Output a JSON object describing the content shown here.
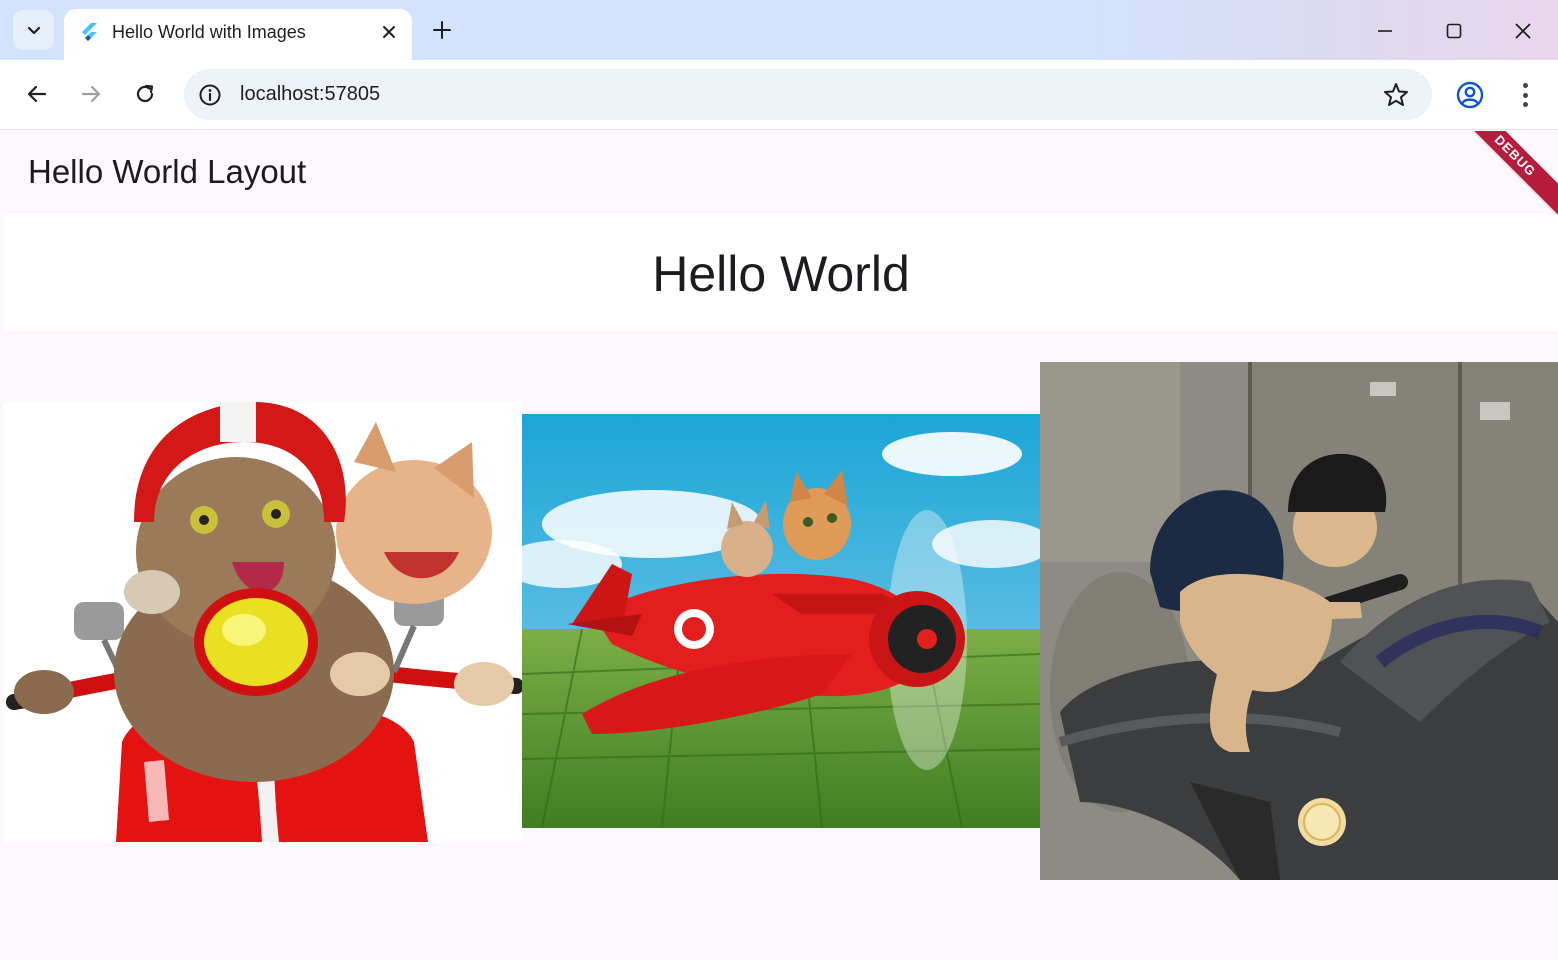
{
  "browser": {
    "tab_title": "Hello World with Images",
    "url": "localhost:57805"
  },
  "app": {
    "appbar_title": "Hello World Layout",
    "debug_banner": "DEBUG",
    "heading": "Hello World",
    "images": [
      {
        "description": "cat-scooter-image"
      },
      {
        "description": "cat-airplane-image"
      },
      {
        "description": "cat-motorbike-image"
      }
    ]
  },
  "colors": {
    "tabstrip": "#d3e3fd",
    "app_background": "#fdf7fe",
    "debug_banner": "#b71c3c"
  }
}
